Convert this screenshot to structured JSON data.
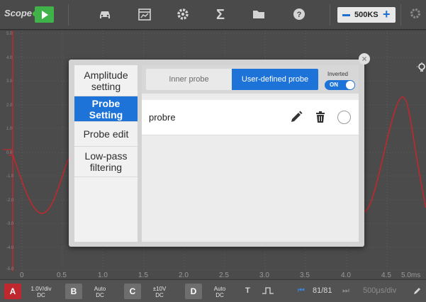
{
  "app": {
    "logo": "Scope"
  },
  "toolbar": {
    "icons": [
      "play-icon",
      "car-icon",
      "calendar-chart-icon",
      "gear-icon",
      "sigma-icon",
      "folder-icon",
      "help-icon",
      "settings-icon"
    ],
    "sample_rate": "500KS",
    "colors": {
      "play": "#3fb34a",
      "accent": "#1e73d8"
    }
  },
  "scope": {
    "y_ticks": [
      "5.0",
      "4.0",
      "3.0",
      "2.0",
      "1.0",
      "0.0",
      "-1.0",
      "-2.0",
      "-3.0",
      "-4.0",
      "-5.0"
    ],
    "x_ticks": [
      "0",
      "0.5",
      "1.0",
      "1.5",
      "2.0",
      "2.5",
      "3.0",
      "3.5",
      "4.0",
      "4.5",
      "5.0ms"
    ],
    "trace_color": "#c0282f"
  },
  "bottom": {
    "ch_a": {
      "label": "A",
      "volts": "1.0V/div",
      "coupling": "DC",
      "color": "#c0282f"
    },
    "ch_b": {
      "label": "B",
      "volts": "Auto",
      "coupling": "DC"
    },
    "ch_c": {
      "label": "C",
      "volts": "±10V",
      "coupling": "DC"
    },
    "ch_d": {
      "label": "D",
      "volts": "Auto",
      "coupling": "DC"
    },
    "trigger": "T",
    "page": "81/81",
    "timebase": "500μs/div"
  },
  "dialog": {
    "sidebar": [
      {
        "label": "Amplitude setting",
        "active": false
      },
      {
        "label": "Probe Setting",
        "active": true
      },
      {
        "label": "Probe edit",
        "active": false
      },
      {
        "label": "Low-pass filtering",
        "active": false
      }
    ],
    "tabs": {
      "inner": "Inner probe",
      "user": "User-defined probe"
    },
    "inverted": {
      "label": "Inverted",
      "state": "ON"
    },
    "probes": [
      {
        "name": "probre"
      }
    ]
  }
}
